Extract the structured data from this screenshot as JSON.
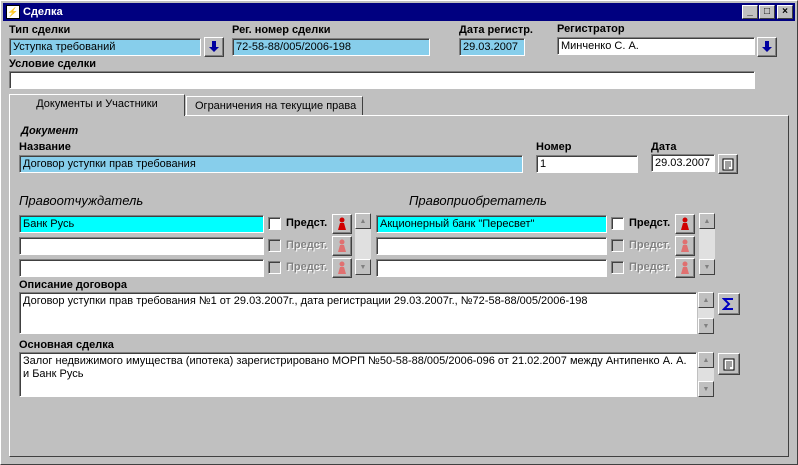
{
  "window": {
    "title": "Сделка"
  },
  "header": {
    "deal_type_label": "Тип сделки",
    "deal_type_value": "Уступка требований",
    "reg_number_label": "Рег. номер сделки",
    "reg_number_value": "72-58-88/005/2006-198",
    "reg_date_label": "Дата регистр.",
    "reg_date_value": "29.03.2007",
    "registrar_label": "Регистратор",
    "registrar_value": "Минченко С. А.",
    "condition_label": "Условие сделки",
    "condition_value": ""
  },
  "tabs": [
    {
      "label": "Документы и Участники",
      "active": true
    },
    {
      "label": "Ограничения на текущие права",
      "active": false
    }
  ],
  "document": {
    "section_label": "Документ",
    "name_label": "Название",
    "name_value": "Договор уступки прав требования",
    "number_label": "Номер",
    "number_value": "1",
    "date_label": "Дата",
    "date_value": "29.03.2007"
  },
  "parties": {
    "alienator_label": "Правоотчуждатель",
    "acquirer_label": "Правоприобретатель",
    "predst_label": "Предст.",
    "alienators": [
      "Банк Русь",
      "",
      ""
    ],
    "acquirers": [
      "Акционерный банк \"Пересвет\"",
      "",
      ""
    ]
  },
  "contract": {
    "label": "Описание договора",
    "value": "Договор уступки прав требования №1 от 29.03.2007г., дата регистрации 29.03.2007г., №72-58-88/005/2006-198"
  },
  "main_deal": {
    "label": "Основная сделка",
    "value": "Залог недвижимого имущества (ипотека) зарегистрировано МОРП №50-58-88/005/2006-096 от 21.02.2007 между Антипенко А. А. и Банк Русь"
  },
  "icons": {
    "dropdown": "arrow-down-icon",
    "calendar": "notepad-icon",
    "person": "person-icon",
    "sum": "sigma-icon"
  },
  "colors": {
    "titlebar": "#000080",
    "field_blue": "#87ceeb",
    "field_cyan": "#00ffff",
    "face": "#c0c0c0"
  }
}
